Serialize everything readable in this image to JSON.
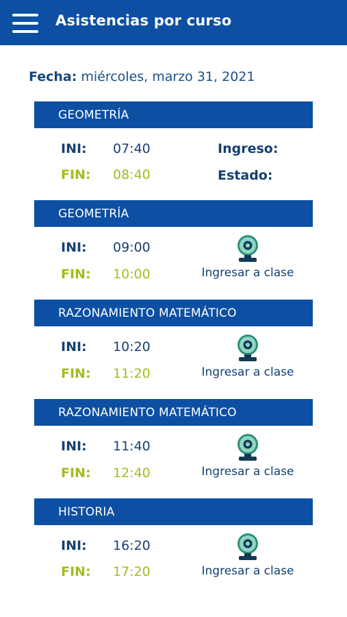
{
  "header": {
    "title": "Asistencias por curso"
  },
  "date": {
    "label": "Fecha:",
    "value": "miércoles, marzo 31, 2021"
  },
  "labels": {
    "ini": "INI:",
    "fin": "FIN:",
    "ingreso": "Ingreso:",
    "estado": "Estado:",
    "join": "Ingresar a clase"
  },
  "icons": {
    "menu": "menu-icon",
    "camera": "webcam-icon"
  },
  "colors": {
    "primary": "#0d4fa3",
    "ini": "#163f73",
    "fin": "#a2bd1e"
  },
  "classes": [
    {
      "name": "GEOMETRÍA",
      "ini": "07:40",
      "fin": "08:40"
    },
    {
      "name": "GEOMETRÍA",
      "ini": "09:00",
      "fin": "10:00"
    },
    {
      "name": "RAZONAMIENTO MATEMÁTICO",
      "ini": "10:20",
      "fin": "11:20"
    },
    {
      "name": "RAZONAMIENTO MATEMÁTICO",
      "ini": "11:40",
      "fin": "12:40"
    },
    {
      "name": "HISTORIA",
      "ini": "16:20",
      "fin": "17:20"
    }
  ]
}
